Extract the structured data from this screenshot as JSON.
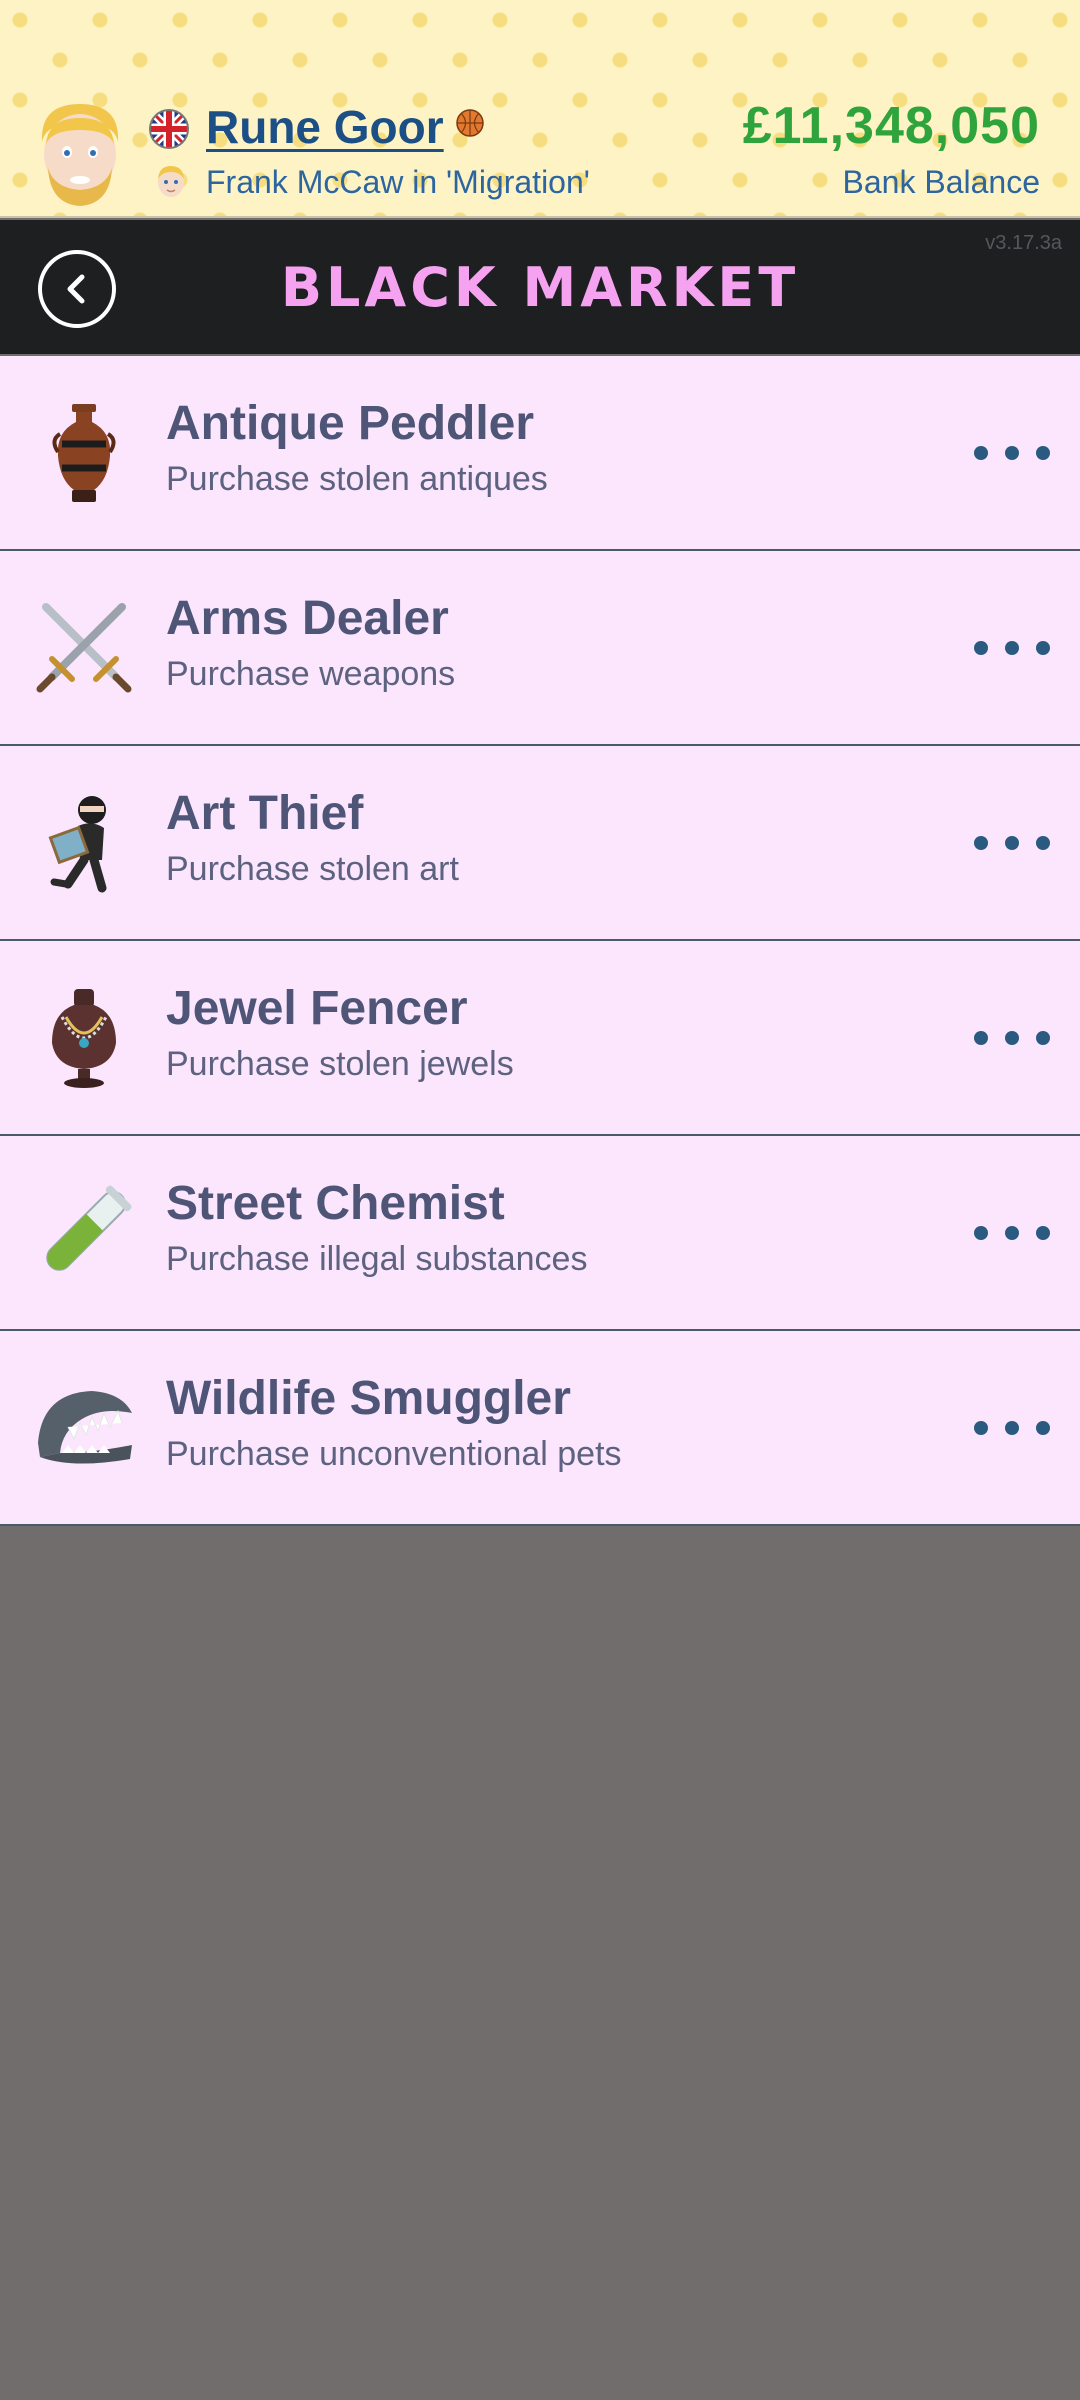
{
  "header": {
    "player_name": "Rune Goor",
    "status": "Frank McCaw in 'Migration'",
    "bank_amount": "£11,348,050",
    "bank_label": "Bank Balance",
    "icons": [
      "avatar-face",
      "uk-flag-icon",
      "basketball-icon",
      "child-avatar"
    ]
  },
  "titlebar": {
    "title": "Black Market",
    "version": "v3.17.3a",
    "back_icon": "chevron-left-icon"
  },
  "items": [
    {
      "title": "Antique Peddler",
      "subtitle": "Purchase stolen antiques",
      "icon": "vase-icon"
    },
    {
      "title": "Arms Dealer",
      "subtitle": "Purchase weapons",
      "icon": "crossed-swords-icon"
    },
    {
      "title": "Art Thief",
      "subtitle": "Purchase stolen art",
      "icon": "thief-icon"
    },
    {
      "title": "Jewel Fencer",
      "subtitle": "Purchase stolen jewels",
      "icon": "necklace-icon"
    },
    {
      "title": "Street Chemist",
      "subtitle": "Purchase illegal substances",
      "icon": "test-tube-icon"
    },
    {
      "title": "Wildlife Smuggler",
      "subtitle": "Purchase unconventional pets",
      "icon": "shark-jaw-icon"
    }
  ],
  "colors": {
    "title_pink": "#f5a3f0",
    "money_green": "#2fa43c",
    "row_background": "#fbe6fd",
    "empty_area": "#716d6c"
  }
}
